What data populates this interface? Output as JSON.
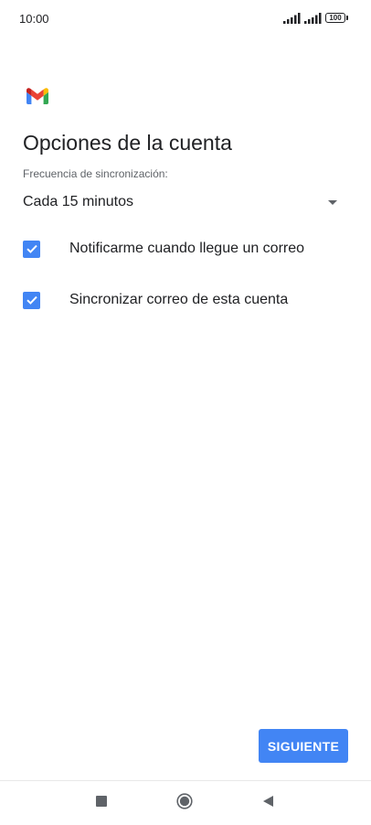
{
  "status_bar": {
    "time": "10:00",
    "battery": "100"
  },
  "app": {
    "logo_icon": "gmail-logo-icon"
  },
  "page": {
    "title": "Opciones de la cuenta",
    "sync_label": "Frecuencia de sincronización:",
    "sync_value": "Cada 15 minutos"
  },
  "options": [
    {
      "label": "Notificarme cuando llegue un correo",
      "checked": true
    },
    {
      "label": "Sincronizar correo de esta cuenta",
      "checked": true
    }
  ],
  "actions": {
    "next_label": "SIGUIENTE"
  },
  "colors": {
    "accent": "#4285f4",
    "text": "#202124",
    "secondary_text": "#5f6368"
  },
  "icons": {
    "signal": "signal-icon",
    "battery": "battery-icon",
    "dropdown": "dropdown-arrow-icon",
    "check": "checkmark-icon",
    "nav_recents": "recents-square-icon",
    "nav_home": "home-circle-icon",
    "nav_back": "back-triangle-icon"
  }
}
